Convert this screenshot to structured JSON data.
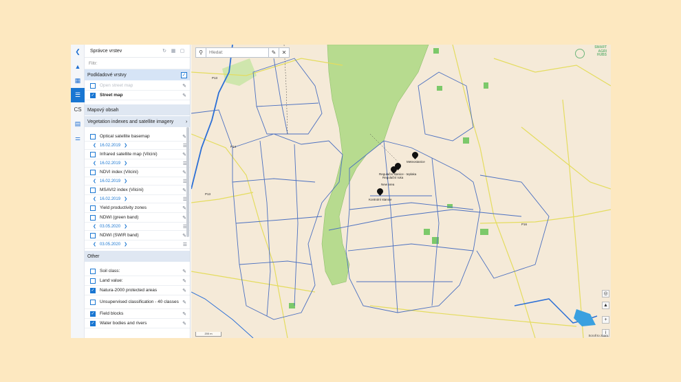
{
  "panel": {
    "title": "Správce vrstev",
    "filter_placeholder": "Filtr:",
    "sections": {
      "base": "Podkladové vrstvy",
      "map_content": "Mapový obsah",
      "veg": "Vegetation indexes and satellite imagery",
      "other": "Other"
    },
    "base_layers": [
      "Open street map",
      "Street map"
    ],
    "veg_layers": [
      {
        "label": "Optical satellite basemap",
        "date": "16.02.2019"
      },
      {
        "label": "Infrared satellite map (Vilcini)",
        "date": "16.02.2019"
      },
      {
        "label": "NDVI index (Vilcini)",
        "date": "16.02.2019"
      },
      {
        "label": "MSAVI2 index (Vilcini)",
        "date": "16.02.2019"
      },
      {
        "label": "Yield productivity zones",
        "date": ""
      },
      {
        "label": "NDWI (green band)",
        "date": ""
      },
      {
        "label": "NDWI (SWIR band)",
        "date": "03.05.2020"
      }
    ],
    "other_layers": [
      {
        "label": "Soil class:",
        "checked": false
      },
      {
        "label": "Land value:",
        "checked": false
      },
      {
        "label": "Natura-2000 protected areas",
        "checked": true
      },
      {
        "label": "Unsupervised classification - 40 classes",
        "checked": false
      },
      {
        "label": "Field blocks",
        "checked": true
      },
      {
        "label": "Water bodies and rivers",
        "checked": true
      }
    ],
    "ndwi_green_date": "03.05.2020"
  },
  "rail": {
    "lang": "CS"
  },
  "search": {
    "placeholder": "Hledat:"
  },
  "map": {
    "labels": {
      "meteo": "Meteostanice",
      "reg1": "Regulační stanice - teplaka",
      "reg2": "Regulační ruka",
      "new_area": "New area",
      "kontrol": "Kontrolní stanice",
      "road1": "P13",
      "road2": "P16",
      "road3": "P14",
      "road4": "P13"
    },
    "logo": [
      "SMART",
      "AGRI",
      "HUBS"
    ],
    "attribution": "Scroll to zoom",
    "scale": "200 m"
  },
  "colors": {
    "accent": "#1976d2",
    "field_lines": "#4a6fc0",
    "forest": "#b7db8f",
    "roads": "#e8df5a"
  }
}
